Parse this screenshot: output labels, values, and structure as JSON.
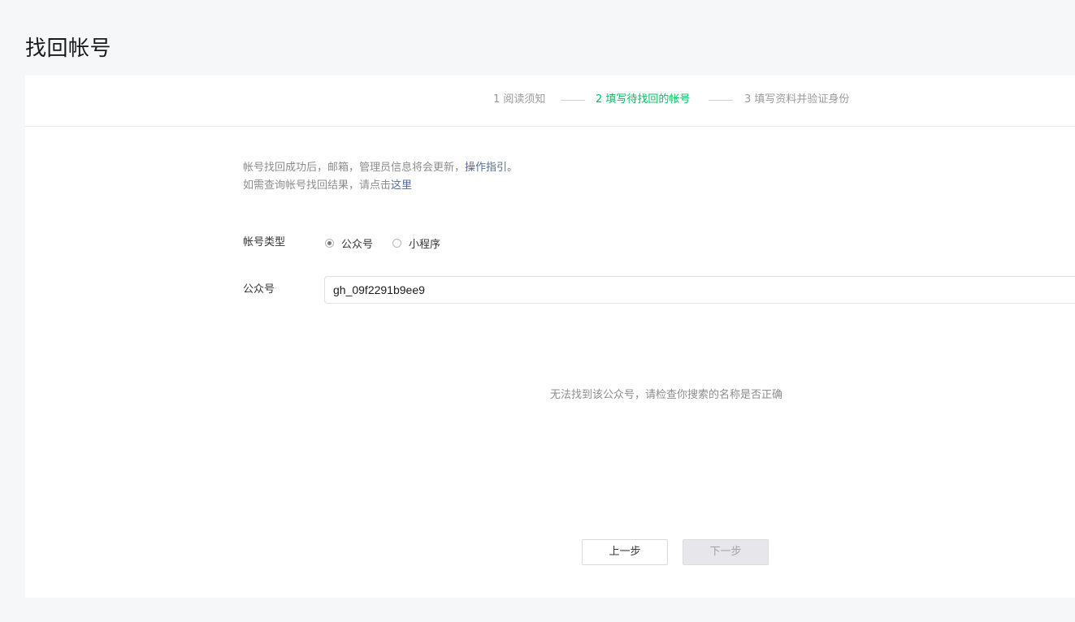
{
  "page": {
    "title": "找回帐号"
  },
  "steps": [
    {
      "label": "1 阅读须知",
      "state": "done"
    },
    {
      "label": "2 填写待找回的帐号",
      "state": "active"
    },
    {
      "label": "3 填写资料并验证身份",
      "state": "pending"
    }
  ],
  "notice": {
    "line1_text": "帐号找回成功后，邮箱，管理员信息将会更新，",
    "line1_link": "操作指引。",
    "line2_text": "如需查询帐号找回结果，请点击",
    "line2_link": "这里"
  },
  "form": {
    "account_type_label": "帐号类型",
    "account_type_options": [
      {
        "label": "公众号",
        "checked": true
      },
      {
        "label": "小程序",
        "checked": false
      }
    ],
    "account_label": "公众号",
    "account_value": "gh_09f2291b9ee9"
  },
  "result": {
    "message": "无法找到该公众号，请检查你搜索的名称是否正确"
  },
  "buttons": {
    "prev_label": "上一步",
    "next_label": "下一步",
    "next_disabled": true
  },
  "colors": {
    "accent": "#07c160",
    "link": "#576b95",
    "background": "#f6f7f9"
  }
}
